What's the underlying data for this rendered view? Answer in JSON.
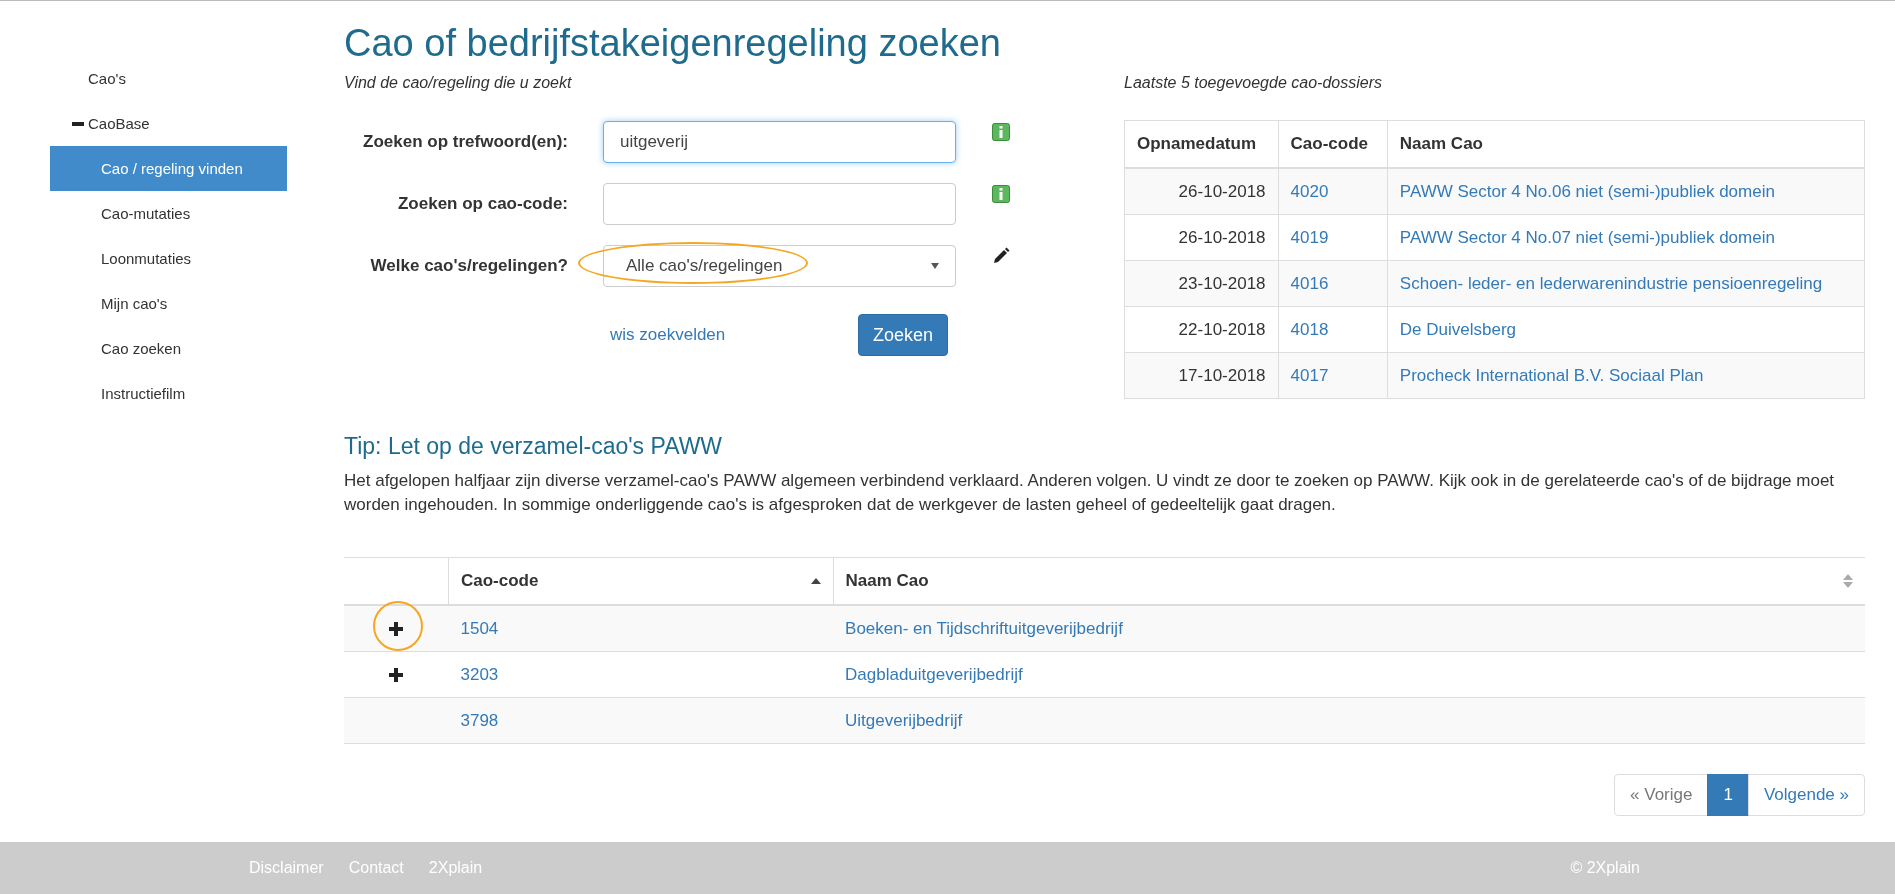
{
  "sidebar": {
    "items": [
      {
        "label": "Cao's",
        "selected": false
      },
      {
        "label": "CaoBase",
        "selected": false,
        "expanded": true,
        "children": [
          {
            "label": "Cao / regeling vinden",
            "selected": true
          },
          {
            "label": "Cao-mutaties",
            "selected": false
          },
          {
            "label": "Loonmutaties",
            "selected": false
          },
          {
            "label": "Mijn cao's",
            "selected": false
          },
          {
            "label": "Cao zoeken",
            "selected": false
          },
          {
            "label": "Instructiefilm",
            "selected": false
          }
        ]
      }
    ]
  },
  "page": {
    "title": "Cao of bedrijfstakeigenregeling zoeken",
    "subtitle": "Vind de cao/regeling die u zoekt"
  },
  "form": {
    "fields": [
      {
        "kind": "text",
        "label": "Zoeken op trefwoord(en):",
        "value": "uitgeverij",
        "focused": true,
        "highlighted": false
      },
      {
        "kind": "text",
        "label": "Zoeken op cao-code:",
        "focused": false,
        "highlighted": false
      },
      {
        "kind": "select",
        "label": "Welke cao's/regelingen?",
        "value": "Alle cao's/regelingen",
        "focused": false,
        "highlighted": true
      }
    ],
    "clear_link": "wis zoekvelden",
    "submit_button": "Zoeken"
  },
  "recent": {
    "title": "Laatste 5 toegevoegde cao-dossiers",
    "columns": [
      "Opnamedatum",
      "Cao-code",
      "Naam Cao"
    ],
    "rows": [
      {
        "date": "26-10-2018",
        "code": "4020",
        "name": "PAWW Sector 4 No.06 niet (semi-)publiek domein"
      },
      {
        "date": "26-10-2018",
        "code": "4019",
        "name": "PAWW Sector 4 No.07 niet (semi-)publiek domein"
      },
      {
        "date": "23-10-2018",
        "code": "4016",
        "name": "Schoen- leder- en lederwarenindustrie pensioenregeling"
      },
      {
        "date": "22-10-2018",
        "code": "4018",
        "name": "De Duivelsberg"
      },
      {
        "date": "17-10-2018",
        "code": "4017",
        "name": "Procheck International B.V. Sociaal Plan"
      }
    ]
  },
  "tip": {
    "title": "Tip: Let op de verzamel-cao's PAWW",
    "text": "Het afgelopen halfjaar zijn diverse verzamel-cao's PAWW algemeen verbindend verklaard. Anderen volgen. U vindt ze door te zoeken op PAWW. Kijk ook in de gerelateerde cao's of de bijdrage moet worden ingehouden. In sommige onderliggende cao's is afgesproken dat de werkgever de lasten geheel of gedeeltelijk gaat dragen."
  },
  "results": {
    "columns": [
      {
        "label": "Cao-code",
        "sorted": true
      },
      {
        "label": "Naam Cao",
        "sorted": false
      }
    ],
    "rows": [
      {
        "code": "1504",
        "name": "Boeken- en Tijdschriftuitgeverijbedrijf",
        "expandable": true,
        "highlighted": true
      },
      {
        "code": "3203",
        "name": "Dagbladuitgeverijbedrijf",
        "expandable": true,
        "highlighted": false
      },
      {
        "code": "3798",
        "name": "Uitgeverijbedrijf",
        "expandable": false,
        "highlighted": false
      }
    ]
  },
  "pagination": [
    {
      "kind": "prev",
      "label": "« Vorige",
      "selected": false
    },
    {
      "kind": "page",
      "label": "1",
      "selected": true
    },
    {
      "kind": "next",
      "label": "Volgende »",
      "selected": false
    }
  ],
  "footer": {
    "links": [
      "Disclaimer",
      "Contact",
      "2Xplain"
    ],
    "copyright": "© 2Xplain"
  }
}
